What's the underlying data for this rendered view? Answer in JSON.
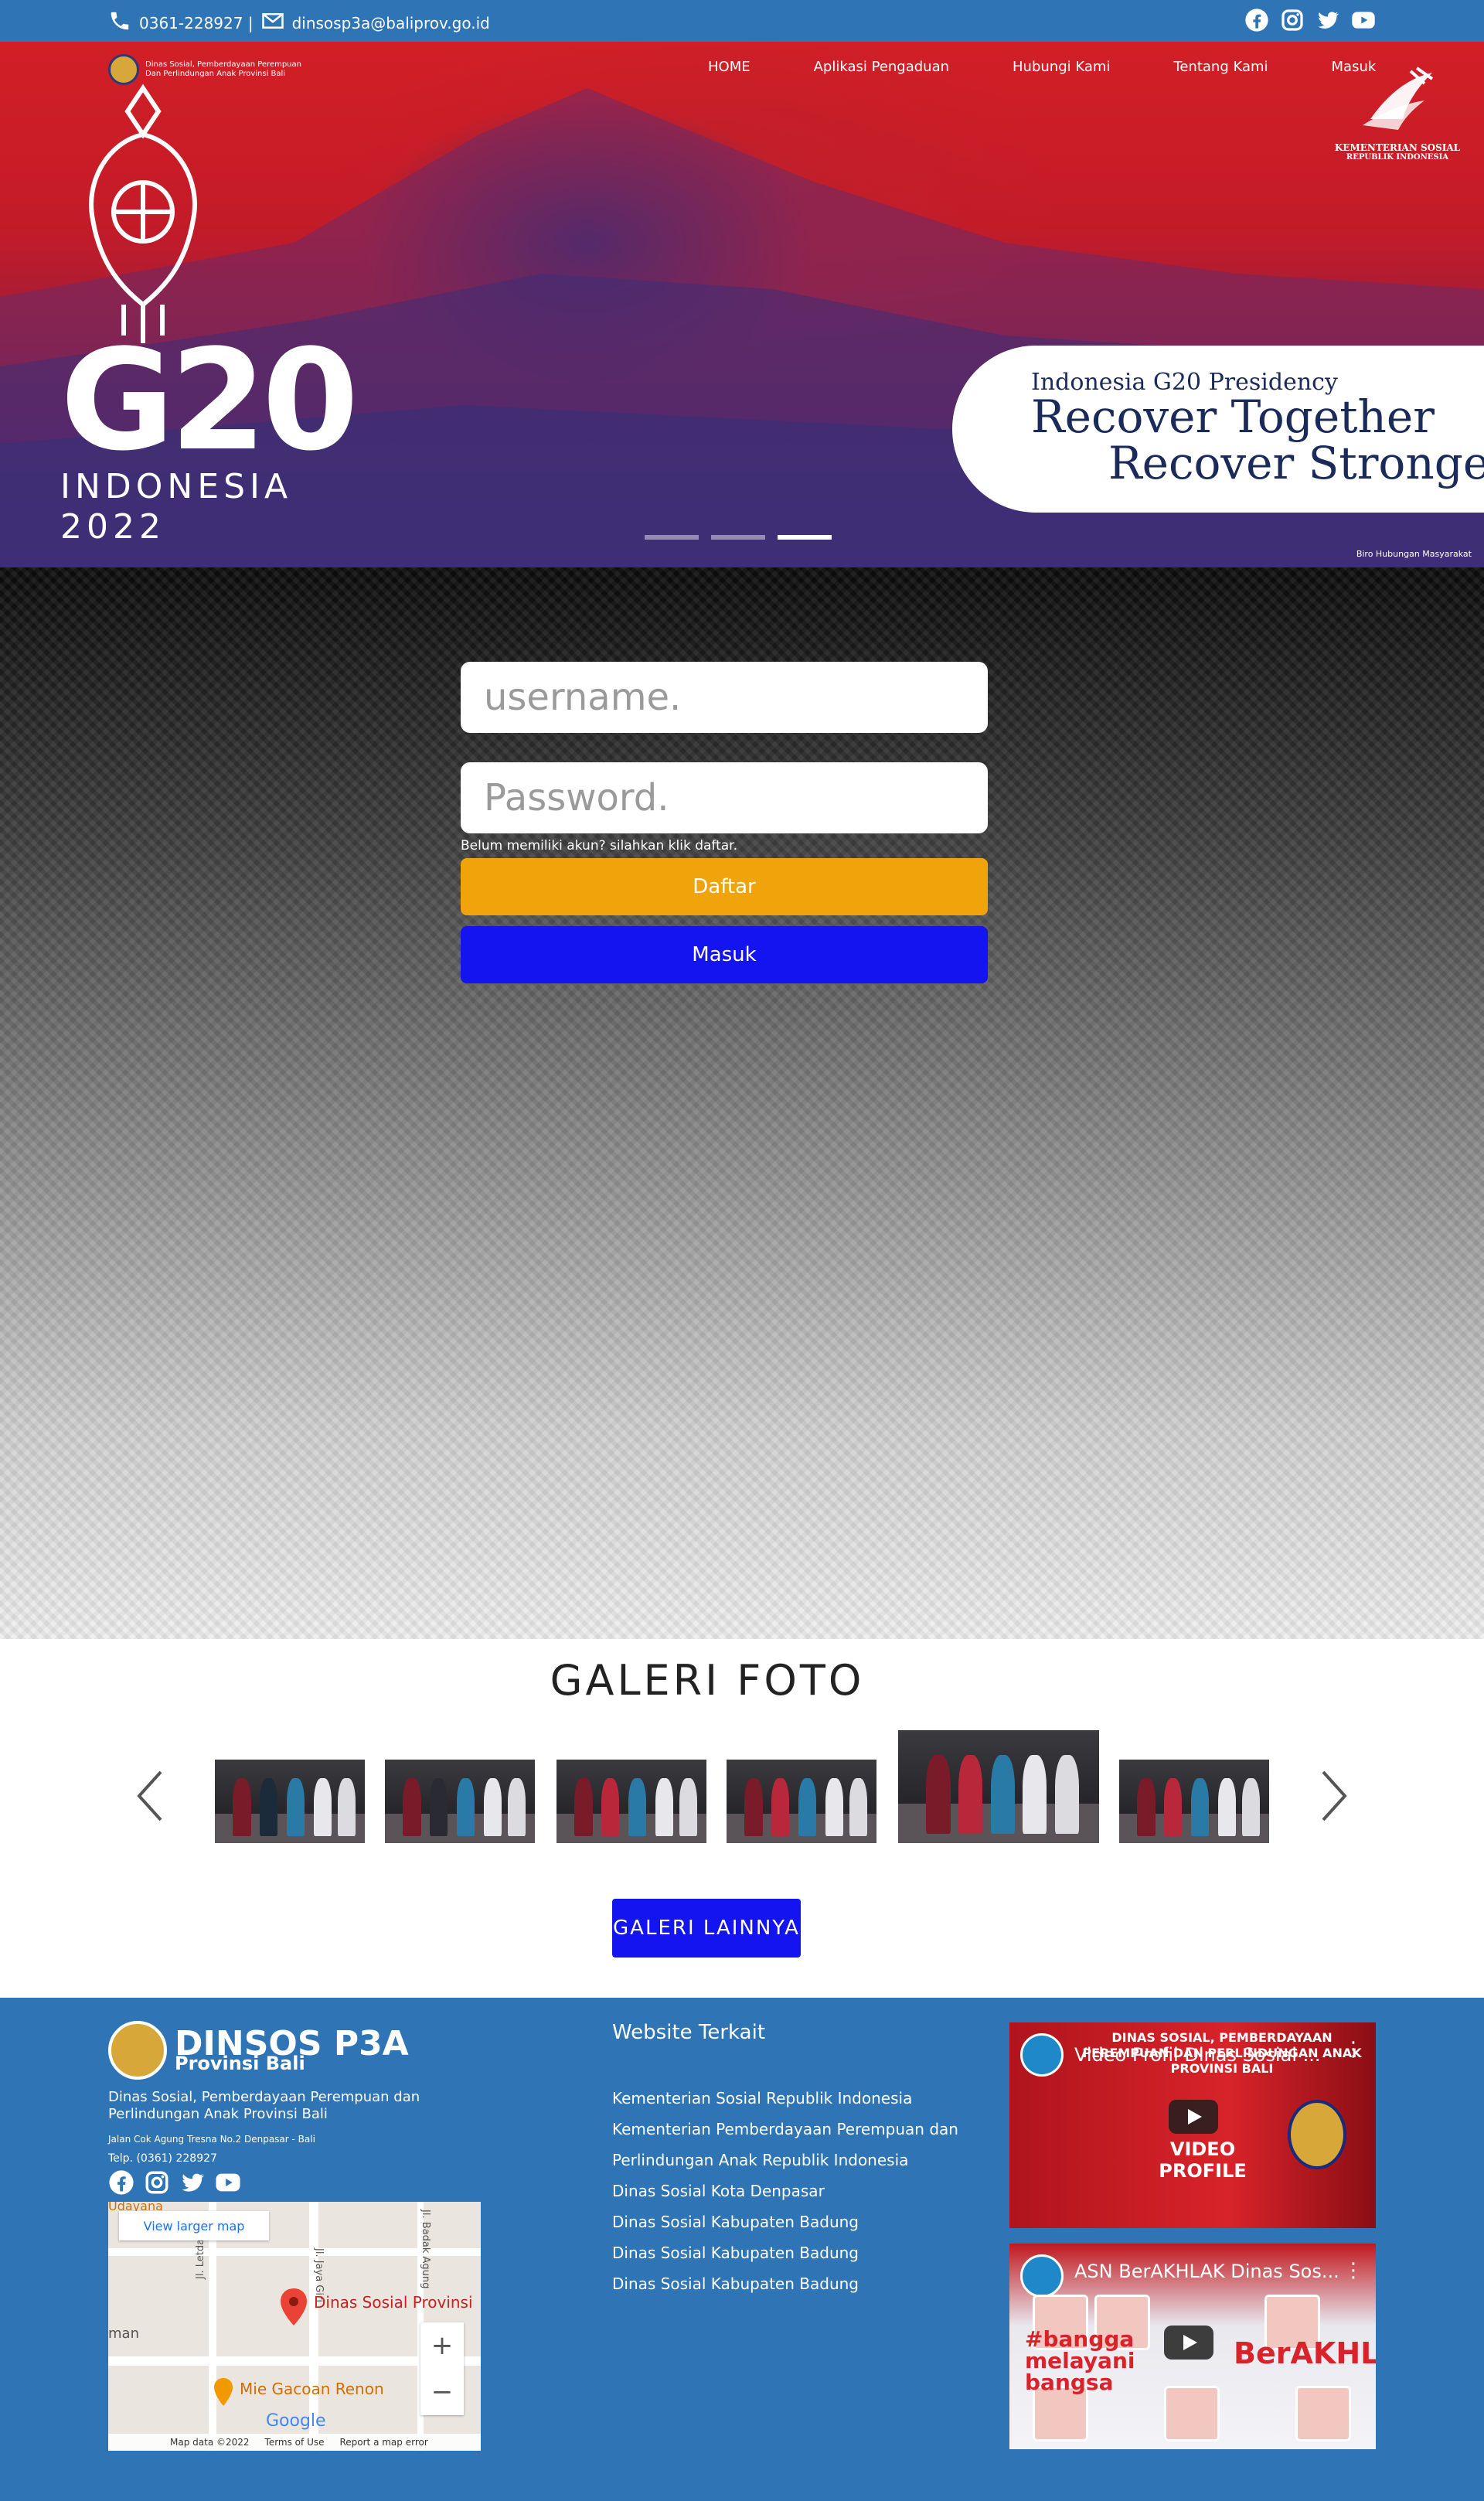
{
  "topbar": {
    "phone": "0361-228927 |",
    "email": "dinsosp3a@baliprov.go.id",
    "social_icons": [
      "facebook-icon",
      "instagram-icon",
      "twitter-icon",
      "youtube-icon"
    ],
    "bg_color": "#2f74b5"
  },
  "header": {
    "logo_text_line1": "Dinas Sosial, Pemberdayaan Perempuan",
    "logo_text_line2": "Dan Perlindungan Anak Provinsi Bali",
    "nav": [
      "HOME",
      "Aplikasi Pengaduan",
      "Hubungi Kami",
      "Tentang Kami",
      "Masuk"
    ],
    "partner_line1": "KEMENTERIAN SOSIAL",
    "partner_line2": "REPUBLIK INDONESIA"
  },
  "hero": {
    "g20": "G20",
    "country": "INDONESIA",
    "year": "2022",
    "presidency": "Indonesia G20 Presidency",
    "slogan1": "Recover Together",
    "slogan2": "Recover Stronger",
    "credit": "Biro Hubungan Masyarakat",
    "slides": 3,
    "active_slide": 3
  },
  "login": {
    "username_placeholder": "username.",
    "password_placeholder": "Password.",
    "hint": "Belum memiliki akun? silahkan klik daftar.",
    "register_label": "Daftar",
    "login_label": "Masuk",
    "register_color": "#f0a30a",
    "login_color": "#1414f0"
  },
  "gallery": {
    "title": "GALERI FOTO",
    "more_label": "GALERI LAINNYA",
    "photo_count": 6
  },
  "footer": {
    "brand": "DINSOS P3A",
    "brand_sub": "Provinsi Bali",
    "desc": "Dinas Sosial, Pemberdayaan Perempuan dan Perlindungan Anak Provinsi Bali",
    "address": "Jalan Cok Agung Tresna No.2 Denpasar - Bali",
    "phone": "Telp. (0361) 228927",
    "map": {
      "larger_map": "View larger map",
      "place1": "Dinas Sosial Provinsi",
      "place2": "Mie Gacoan Renon",
      "area": "Udayana",
      "area2": "man",
      "street1": "Jl. Letda",
      "street2": "Jl. Jaya Giri",
      "street3": "Jl. Badak Agung",
      "google": "Google",
      "map_data": "Map data ©2022",
      "terms": "Terms of Use",
      "report": "Report a map error",
      "zoom_in": "+",
      "zoom_out": "−"
    },
    "sites_heading": "Website Terkait",
    "sites": [
      "Kementerian Sosial Republik Indonesia",
      "Kementerian Pemberdayaan Perempuan dan",
      "Perlindungan Anak Republik Indonesia",
      "Dinas Sosial Kota Denpasar",
      "Dinas Sosial Kabupaten Badung",
      "Dinas Sosial Kabupaten Badung",
      "Dinas Sosial Kabupaten Badung"
    ],
    "video1_title": "Video Profil Dinas Sosial ...",
    "video1_banner": "DINAS SOSIAL, PEMBERDAYAAN PEREMPUAN DAN PERLINDUNGAN ANAK PROVINSI BALI",
    "video1_label": "VIDEO PROFILE",
    "video2_title": "ASN BerAKHLAK Dinas Sos...",
    "video2_tag": "#bangga melayani bangsa",
    "video2_tag2": "BerAKHLAK"
  }
}
